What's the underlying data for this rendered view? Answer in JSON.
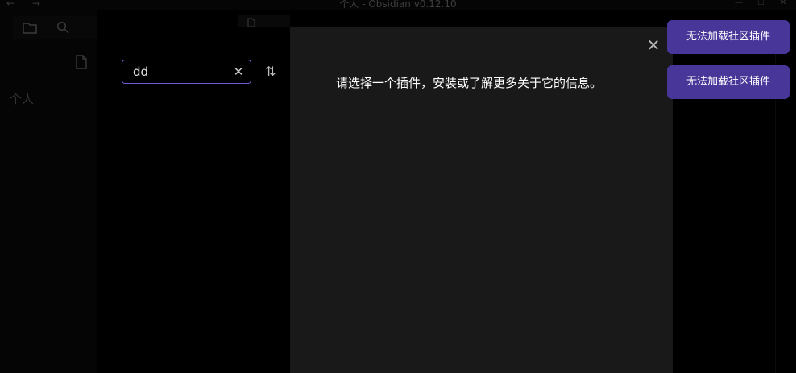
{
  "window": {
    "title": "个人 - Obsidian v0.12.10",
    "back_glyph": "←",
    "forward_glyph": "→",
    "minimize_glyph": "—",
    "maximize_glyph": "☐",
    "close_glyph": "✕"
  },
  "sidebar": {
    "vault_name": "个人",
    "icons": [
      "folder-icon",
      "search-icon",
      "new-file-icon"
    ]
  },
  "plugin_browser": {
    "search": {
      "value": "dd",
      "placeholder": "",
      "clear_glyph": "✕"
    },
    "sort_glyph": "⇅",
    "close_glyph": "✕",
    "empty_message": "请选择一个插件，安装或了解更多关于它的信息。"
  },
  "notices": [
    {
      "text": "无法加载社区插件"
    },
    {
      "text": "无法加载社区插件"
    }
  ],
  "colors": {
    "accent": "#483699",
    "focus_border": "#6a5acd",
    "detail_bg": "#191919",
    "app_bg": "#000000"
  }
}
